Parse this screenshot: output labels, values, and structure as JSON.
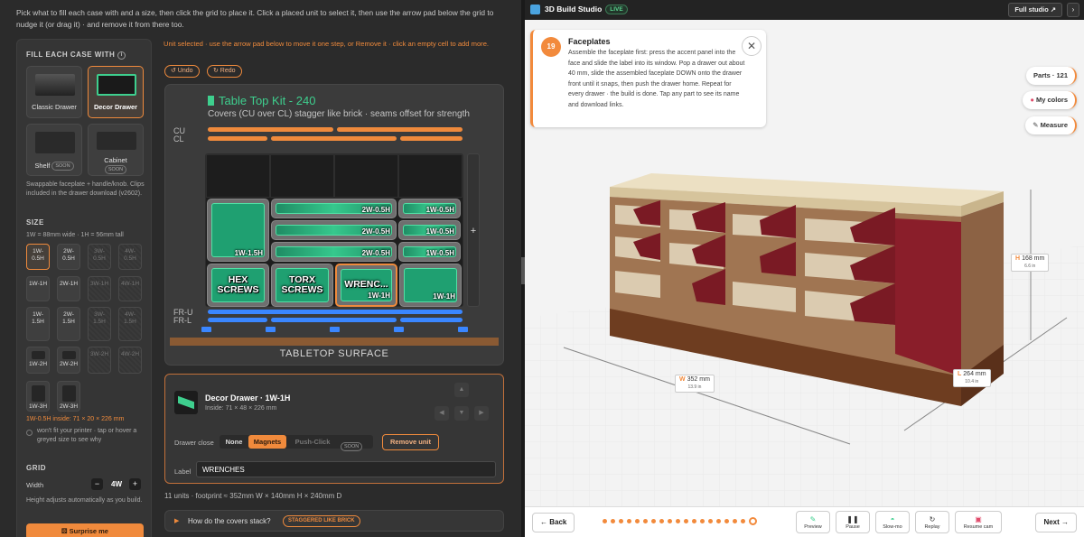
{
  "left": {
    "intro": "Pick what to fill each case with and a size, then click the grid to place it. Click a placed unit to select it, then use the arrow pad below the grid to nudge it (or drag it) · and remove it from there too.",
    "fill_title": "FILL EACH CASE WITH",
    "fill_cards": [
      {
        "label": "Classic Drawer",
        "soon": ""
      },
      {
        "label": "Decor Drawer",
        "soon": ""
      },
      {
        "label": "Shelf",
        "soon": "SOON"
      },
      {
        "label": "Cabinet",
        "soon": "SOON"
      }
    ],
    "fill_note": "Swappable faceplate + handle/knob. Clips included in the drawer download (v2602).",
    "size_title": "SIZE",
    "size_note": "1W = 88mm wide · 1H = 56mm tall",
    "sizes": [
      [
        "1W-0.5H",
        "2W-0.5H",
        "3W-0.5H",
        "4W-0.5H"
      ],
      [
        "1W-1H",
        "2W-1H",
        "3W-1H",
        "4W-1H"
      ],
      [
        "1W-1.5H",
        "2W-1.5H",
        "3W-1.5H",
        "4W-1.5H"
      ],
      [
        "1W-2H",
        "2W-2H",
        "3W-2H",
        "4W-2H"
      ],
      [
        "1W-3H",
        "2W-3H"
      ]
    ],
    "inside_warn": "1W-0.5H inside: 71 × 20 × 226 mm",
    "printer_note": "won't fit your printer · tap or hover a greyed size to see why",
    "grid_title": "GRID",
    "width_label": "Width",
    "width_value": "4W",
    "width_note": "Height adjusts automatically as you build.",
    "surprise": "Surprise me",
    "hint": "Unit selected · use the arrow pad below to move it one step, or Remove it · click an empty cell to add more.",
    "undo": "↺ Undo",
    "redo": "↻ Redo",
    "board": {
      "title": "Table Top Kit - 240",
      "subtitle": "Covers (CU over CL) stagger like brick · seams offset for strength",
      "cu": "CU",
      "cl": "CL",
      "fru": "FR-U",
      "frl": "FR-L",
      "plus": "+",
      "surface": "TABLETOP SURFACE",
      "units": {
        "u1": "1W-1.5H",
        "u2": "2W-0.5H",
        "u3": "2W-0.5H",
        "u4": "2W-0.5H",
        "u5": "1W-0.5H",
        "u6": "1W-0.5H",
        "u7": "1W-0.5H",
        "hex": "HEX\nSCREWS",
        "torx": "TORX\nSCREWS",
        "wrench": "WRENC...",
        "wrench_tag": "1W-1H",
        "u10": "1W-1H"
      }
    },
    "selected": {
      "title": "Decor Drawer · 1W-1H",
      "inside": "Inside: 71 × 48 × 226 mm",
      "close_label": "Drawer close",
      "options": [
        "None",
        "Magnets",
        "Push-Click"
      ],
      "soon": "SOON",
      "remove": "Remove unit",
      "label_label": "Label",
      "label_value": "WRENCHES"
    },
    "summary": "11 units · footprint ≈ 352mm W × 140mm H × 240mm D",
    "how_q": "How do the covers stack?",
    "how_badge": "STAGGERED LIKE BRICK"
  },
  "right": {
    "app_title": "3D Build Studio",
    "live": "LIVE",
    "full": "Full studio ↗",
    "chevron": "›",
    "step": {
      "num": "19",
      "title": "Faceplates",
      "body": "Assemble the faceplate first: press the accent panel into the face and slide the label into its window. Pop a drawer out about 40 mm, slide the assembled faceplate DOWN onto the drawer front until it snaps, then push the drawer home. Repeat for every drawer · the build is done. Tap any part to see its name and download links."
    },
    "parts": "Parts · 121",
    "colors": "My colors",
    "measure": "Measure",
    "dims": {
      "h": {
        "k": "H",
        "v": "168 mm",
        "s": "6.6 in"
      },
      "w": {
        "k": "W",
        "v": "352 mm",
        "s": "13.9 in"
      },
      "l": {
        "k": "L",
        "v": "264 mm",
        "s": "10.4 in"
      }
    },
    "back": "← Back",
    "next": "Next →",
    "controls": [
      "Preview",
      "Pause",
      "Slow-mo",
      "Replay",
      "Resume cam"
    ],
    "progress_steps": 19,
    "progress_current": 19
  },
  "colors": {
    "accent": "#ef8a3c",
    "green": "#3ecf8e",
    "blue": "#3a86ff"
  }
}
